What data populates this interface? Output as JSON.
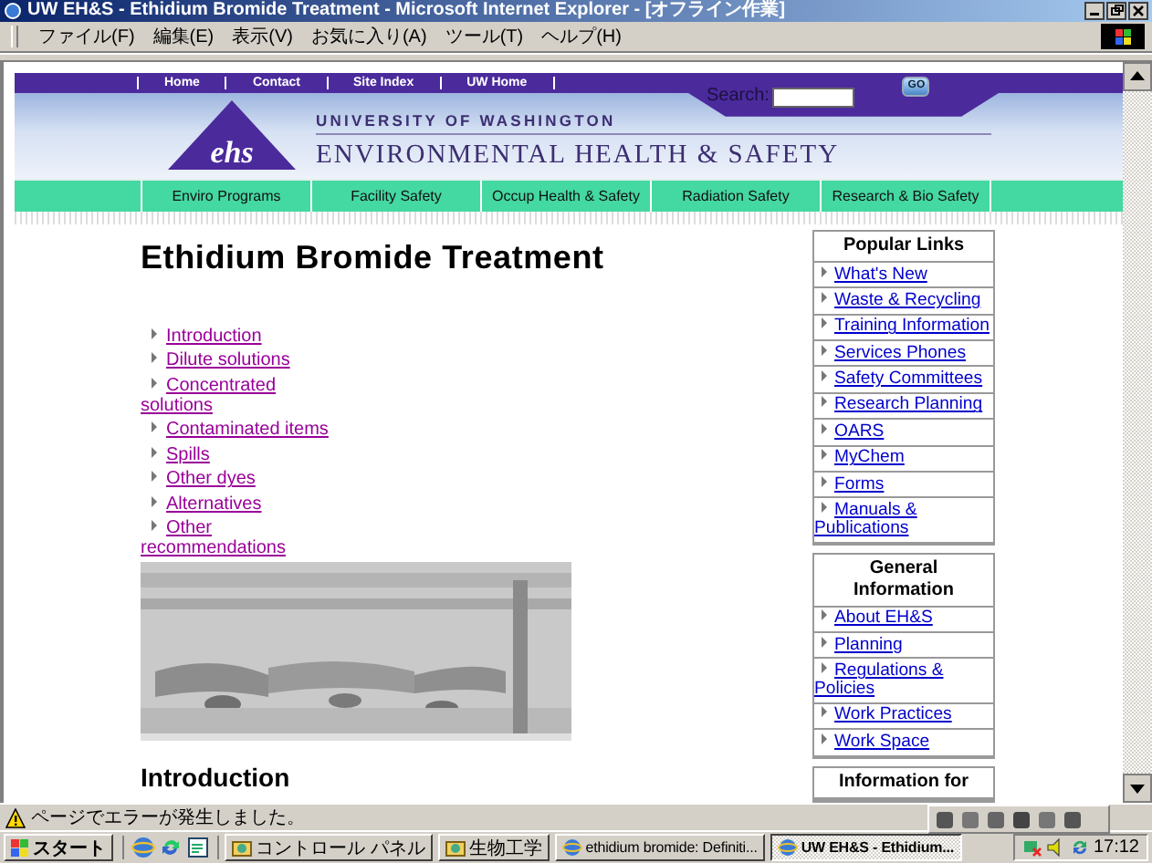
{
  "window": {
    "title": "UW EH&S - Ethidium Bromide Treatment - Microsoft Internet Explorer - [オフライン作業]"
  },
  "menu": [
    "ファイル(F)",
    "編集(E)",
    "表示(V)",
    "お気に入り(A)",
    "ツール(T)",
    "ヘルプ(H)"
  ],
  "page": {
    "top_links": [
      "Home",
      "Contact",
      "Site Index",
      "UW Home"
    ],
    "search": {
      "label": "Search:",
      "button": "GO"
    },
    "logo": "ehs",
    "university": "UNIVERSITY OF WASHINGTON",
    "department": "ENVIRONMENTAL HEALTH & SAFETY",
    "section_nav": [
      "Enviro Programs",
      "Facility Safety",
      "Occup Health & Safety",
      "Radiation Safety",
      "Research & Bio Safety"
    ],
    "title": "Ethidium Bromide Treatment",
    "contents": [
      "Introduction",
      "Dilute solutions",
      "Concentrated solutions",
      "Contaminated items",
      "Spills",
      "Other dyes",
      "Alternatives",
      "Other recommendations"
    ],
    "figure": {
      "kind": "picture"
    },
    "section_heading": "Introduction",
    "sidebar": [
      {
        "title": "Popular Links",
        "links": [
          "What's New",
          "Waste & Recycling",
          "Training Information",
          "Services Phones",
          "Safety Committees",
          "Research Planning",
          "OARS",
          "MyChem",
          "Forms",
          "Manuals & Publications"
        ]
      },
      {
        "title": "General Information",
        "links": [
          "About EH&S",
          "Planning",
          "Regulations & Policies",
          "Work Practices",
          "Work Space"
        ]
      },
      {
        "title": "Information for"
      }
    ]
  },
  "status_bar": {
    "text": "ページでエラーが発生しました。"
  },
  "taskbar": {
    "start": "スタート",
    "tasks": [
      {
        "label": "コントロール パネル",
        "selected": false
      },
      {
        "label": "生物工学",
        "selected": false
      },
      {
        "label": "ethidium bromide: Definiti...",
        "selected": false
      },
      {
        "label": "UW EH&S - Ethidium...",
        "selected": true
      }
    ],
    "clock": "17:12"
  }
}
